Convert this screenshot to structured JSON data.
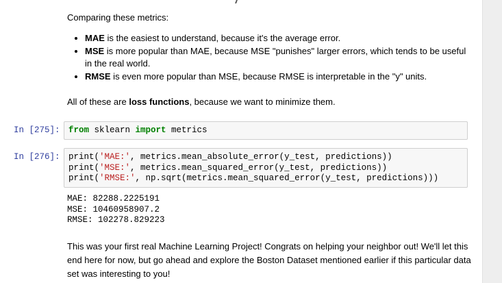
{
  "cells": {
    "md_metrics": {
      "intro": "Comparing these metrics:",
      "bullets": [
        {
          "term": "MAE",
          "text": " is the easiest to understand, because it's the average error."
        },
        {
          "term": "MSE",
          "text": " is more popular than MAE, because MSE \"punishes\" larger errors, which tends to be useful in the real world."
        },
        {
          "term": "RMSE",
          "text": " is even more popular than MSE, because RMSE is interpretable in the \"y\" units."
        }
      ]
    },
    "md_loss": {
      "before": "All of these are ",
      "bold": "loss functions",
      "after": ", because we want to minimize them."
    },
    "code_275": {
      "prompt": "In [275]:",
      "kw_from": "from",
      "module": " sklearn ",
      "kw_import": "import",
      "name": " metrics"
    },
    "code_276": {
      "prompt": "In [276]:",
      "lines": [
        {
          "pre": "print(",
          "str": "'MAE:'",
          "post": ", metrics.mean_absolute_error(y_test, predictions))"
        },
        {
          "pre": "print(",
          "str": "'MSE:'",
          "post": ", metrics.mean_squared_error(y_test, predictions))"
        },
        {
          "pre": "print(",
          "str": "'RMSE:'",
          "post": ", np.sqrt(metrics.mean_squared_error(y_test, predictions)))"
        }
      ],
      "output": [
        "MAE: 82288.2225191",
        "MSE: 10460958907.2",
        "RMSE: 102278.829223"
      ]
    },
    "md_final": {
      "text": "This was your first real Machine Learning Project! Congrats on helping your neighbor out! We'll let this end here for now, but go ahead and explore the Boston Dataset mentioned earlier if this particular data set was interesting to you!"
    }
  }
}
